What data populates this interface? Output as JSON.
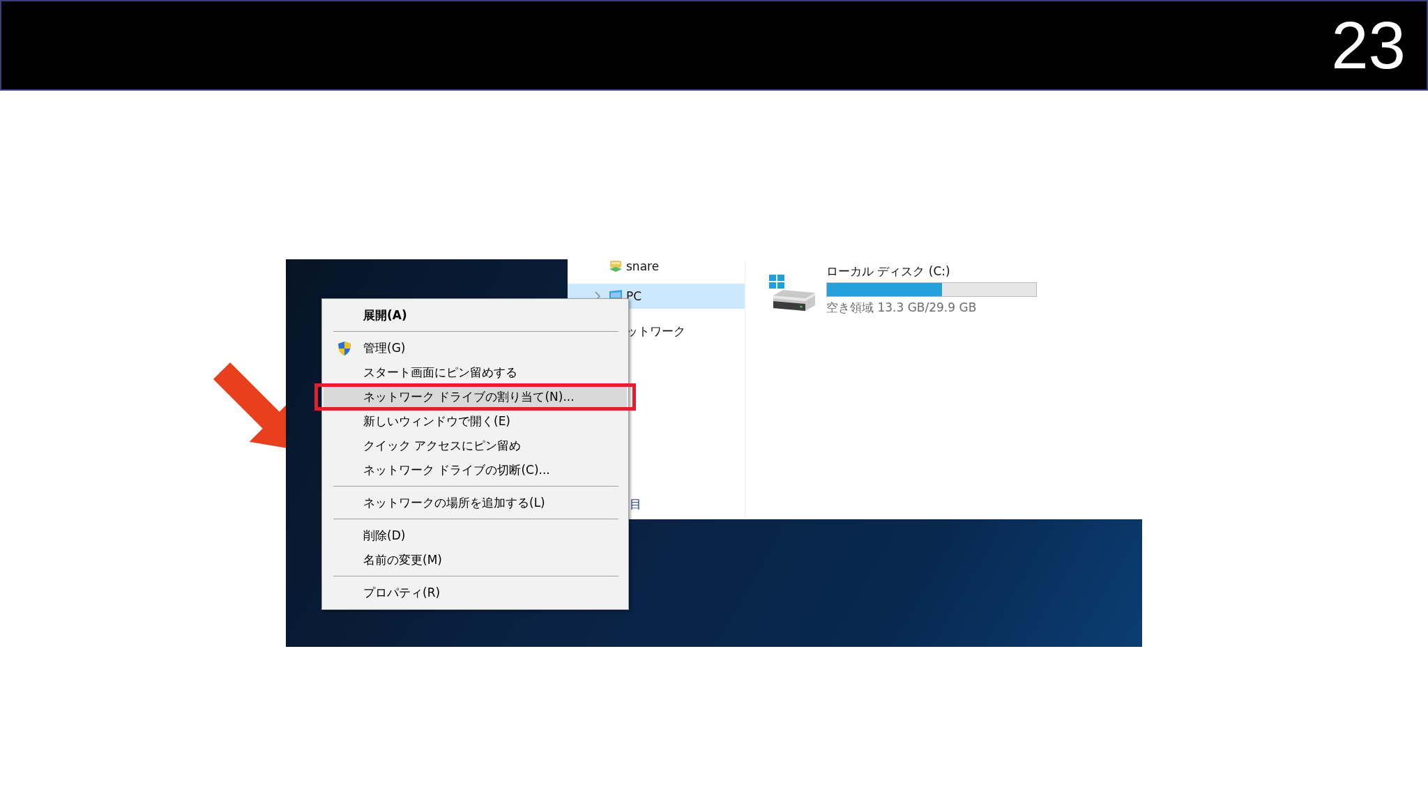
{
  "slide": {
    "page_number": "23"
  },
  "explorer": {
    "nav_items": [
      {
        "label": "snare",
        "selected": false
      },
      {
        "label": "PC",
        "selected": true
      },
      {
        "label": "ットワーク",
        "selected": false
      }
    ],
    "status_text": "目",
    "drive": {
      "name": "ローカル ディスク (C:)",
      "level": 0.55,
      "free_space": "空き領域 13.3 GB/29.9 GB"
    }
  },
  "context_menu": {
    "items": [
      {
        "kind": "item",
        "label": "展開(A)",
        "bold": true,
        "selected": false
      },
      {
        "kind": "separator"
      },
      {
        "kind": "item",
        "label": "管理(G)",
        "bold": false,
        "selected": false
      },
      {
        "kind": "item",
        "label": "スタート画面にピン留めする",
        "bold": false,
        "selected": false
      },
      {
        "kind": "item",
        "label": "ネットワーク ドライブの割り当て(N)...",
        "bold": false,
        "selected": true
      },
      {
        "kind": "item",
        "label": "新しいウィンドウで開く(E)",
        "bold": false,
        "selected": false
      },
      {
        "kind": "item",
        "label": "クイック アクセスにピン留め",
        "bold": false,
        "selected": false
      },
      {
        "kind": "item",
        "label": "ネットワーク ドライブの切断(C)...",
        "bold": false,
        "selected": false
      },
      {
        "kind": "separator"
      },
      {
        "kind": "item",
        "label": "ネットワークの場所を追加する(L)",
        "bold": false,
        "selected": false
      },
      {
        "kind": "separator"
      },
      {
        "kind": "item",
        "label": "削除(D)",
        "bold": false,
        "selected": false
      },
      {
        "kind": "item",
        "label": "名前の変更(M)",
        "bold": false,
        "selected": false
      },
      {
        "kind": "separator"
      },
      {
        "kind": "item",
        "label": "プロパティ(R)",
        "bold": false,
        "selected": false
      }
    ]
  }
}
